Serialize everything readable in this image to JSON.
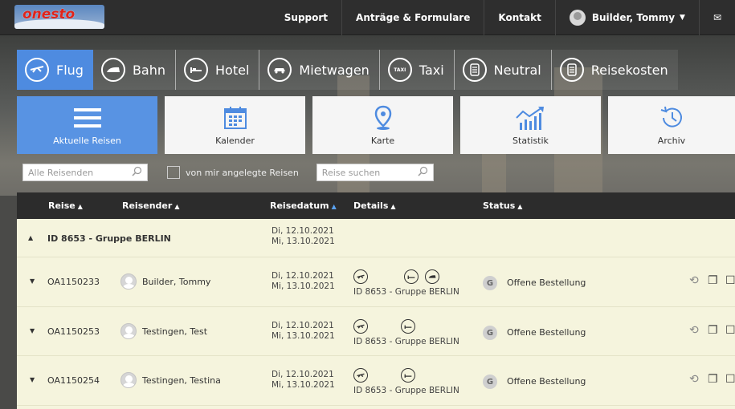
{
  "brand": {
    "logo_text": "onesto"
  },
  "topnav": {
    "support": "Support",
    "forms": "Anträge & Formulare",
    "contact": "Kontakt",
    "user": "Builder, Tommy"
  },
  "modes": [
    {
      "label": "Flug",
      "icon": "plane-icon",
      "active": true
    },
    {
      "label": "Bahn",
      "icon": "train-icon"
    },
    {
      "label": "Hotel",
      "icon": "bed-icon"
    },
    {
      "label": "Mietwagen",
      "icon": "car-icon"
    },
    {
      "label": "Taxi",
      "icon": "taxi-icon",
      "glyph": "TAXI"
    },
    {
      "label": "Neutral",
      "icon": "document-icon"
    },
    {
      "label": "Reisekosten",
      "icon": "receipt-icon"
    }
  ],
  "tiles": [
    {
      "label": "Aktuelle Reisen",
      "icon": "list-icon",
      "active": true
    },
    {
      "label": "Kalender",
      "icon": "calendar-icon"
    },
    {
      "label": "Karte",
      "icon": "map-pin-icon"
    },
    {
      "label": "Statistik",
      "icon": "chart-icon"
    },
    {
      "label": "Archiv",
      "icon": "history-icon"
    }
  ],
  "filters": {
    "travelers_placeholder": "Alle Reisenden",
    "own_trips_label": "von mir angelegte Reisen",
    "search_placeholder": "Reise suchen"
  },
  "table": {
    "headers": {
      "trip": "Reise",
      "traveler": "Reisender",
      "date": "Reisedatum",
      "details": "Details",
      "status": "Status"
    },
    "group": {
      "title": "ID 8653 - Gruppe BERLIN",
      "date_from": "Di,  12.10.2021",
      "date_to": "Mi,  13.10.2021"
    },
    "rows": [
      {
        "id": "OA1150233",
        "traveler": "Builder, Tommy",
        "date_from": "Di,  12.10.2021",
        "date_to": "Mi,  13.10.2021",
        "detail_text": "ID 8653 - Gruppe BERLIN",
        "badge": "G",
        "status": "Offene Bestellung"
      },
      {
        "id": "OA1150253",
        "traveler": "Testingen, Test",
        "date_from": "Di,  12.10.2021",
        "date_to": "Mi,  13.10.2021",
        "detail_text": "ID 8653 - Gruppe BERLIN",
        "badge": "G",
        "status": "Offene Bestellung"
      },
      {
        "id": "OA1150254",
        "traveler": "Testingen, Testina",
        "date_from": "Di,  12.10.2021",
        "date_to": "Mi,  13.10.2021",
        "detail_text": "ID 8653 - Gruppe BERLIN",
        "badge": "G",
        "status": "Offene Bestellung"
      }
    ]
  },
  "colors": {
    "accent": "#4e8be0",
    "topbar": "#2e2e2e",
    "row_bg": "#f5f4dd"
  }
}
